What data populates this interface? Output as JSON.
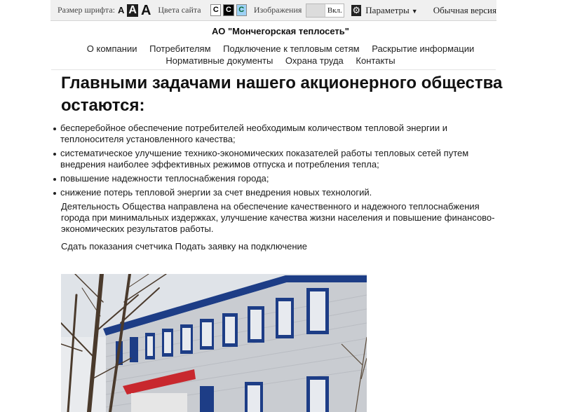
{
  "toolbar": {
    "font_size_label": "Размер шрифта:",
    "font_size_options": [
      "A",
      "A",
      "A"
    ],
    "colors_label": "Цвета сайта",
    "color_options": [
      "C",
      "C",
      "C"
    ],
    "images_label": "Изображения",
    "images_toggle": "Вкл.",
    "settings_label": "Параметры",
    "normal_version": "Обычная версия"
  },
  "header": {
    "org_name": "АО \"Мончегорская теплосеть\""
  },
  "nav": {
    "row1": [
      "О компании",
      "Потребителям",
      "Подключение к тепловым сетям",
      "Раскрытие информации"
    ],
    "row2": [
      "Нормативные документы",
      "Охрана труда",
      "Контакты"
    ]
  },
  "main": {
    "title": "Главными задачами нашего акционерного общества остаются:",
    "tasks": [
      "бесперебойное обеспечение потребителей необходимым количеством тепловой энергии и теплоносителя установленного качества;",
      "систематическое улучшение технико-экономических показателей работы тепловых сетей путем внедрения наиболее эффективных режимов отпуска и потребления тепла;",
      "повышение надежности теплоснабжения города;",
      "снижение потерь тепловой энергии за счет внедрения новых технологий."
    ],
    "paragraph": "Деятельность Общества направлена на обеспечение качественного и надежного теплоснабжения города при минимальных издержках, улучшение качества жизни населения и повышение финансово-экономических результатов работы.",
    "link_meter": "Сдать показания счетчика",
    "link_request": "Подать заявку на подключение"
  },
  "colors": {
    "building_wall": "#c9ccd1",
    "window_frame": "#1d3d86",
    "canopy": "#c8282e"
  }
}
